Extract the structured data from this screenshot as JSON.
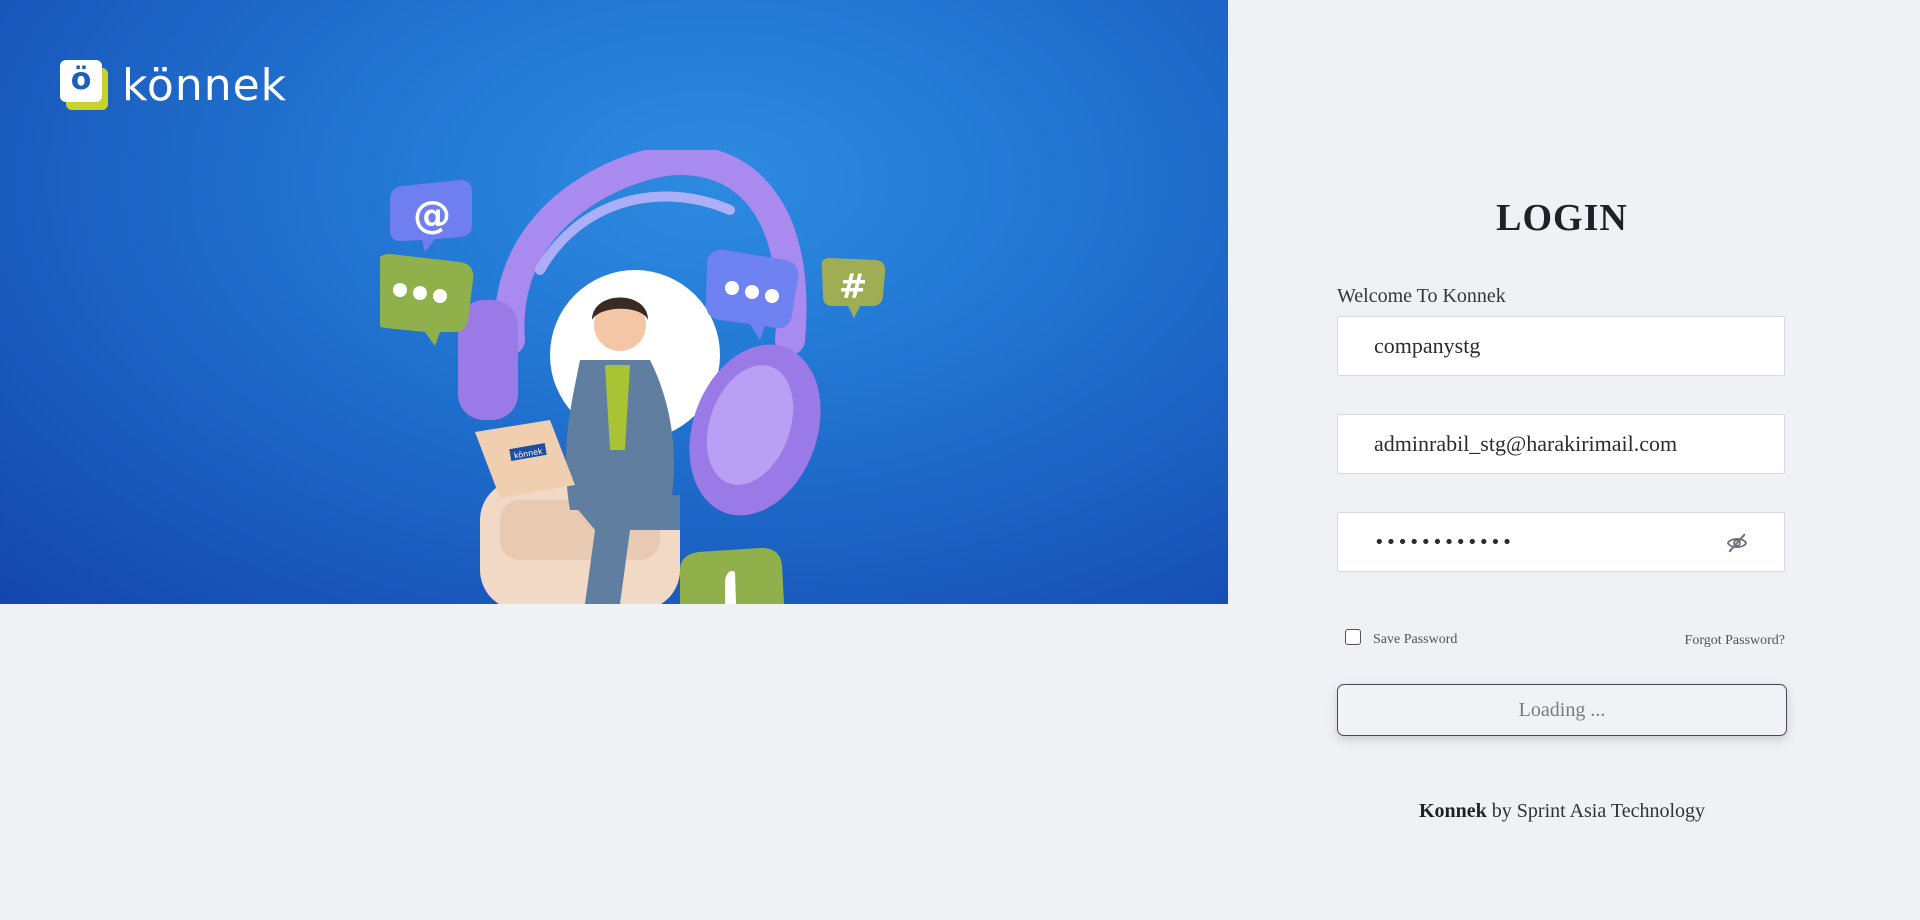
{
  "hero": {
    "logo_mark": "ö",
    "logo_text": "könnek",
    "illustration_bubbles": {
      "at_symbol": "@",
      "hash_symbol": "#"
    },
    "laptop_label": "könnek"
  },
  "login": {
    "title": "LOGIN",
    "welcome": "Welcome To Konnek",
    "company_value": "companystg",
    "email_value": "adminrabil_stg@harakirimail.com",
    "password_masked": "••••••••••••",
    "save_password_label": "Save Password",
    "save_password_checked": false,
    "forgot_password_label": "Forgot Password?",
    "submit_label": "Loading ..."
  },
  "footer": {
    "brand": "Konnek",
    "tagline": " by Sprint Asia Technology"
  },
  "colors": {
    "hero_blue": "#1c63c4",
    "logo_accent": "#c8d22b",
    "page_bg": "#f0f1f4",
    "button_border": "#3f4a5c"
  },
  "icons": {
    "password_toggle": "eye-slash-icon"
  }
}
